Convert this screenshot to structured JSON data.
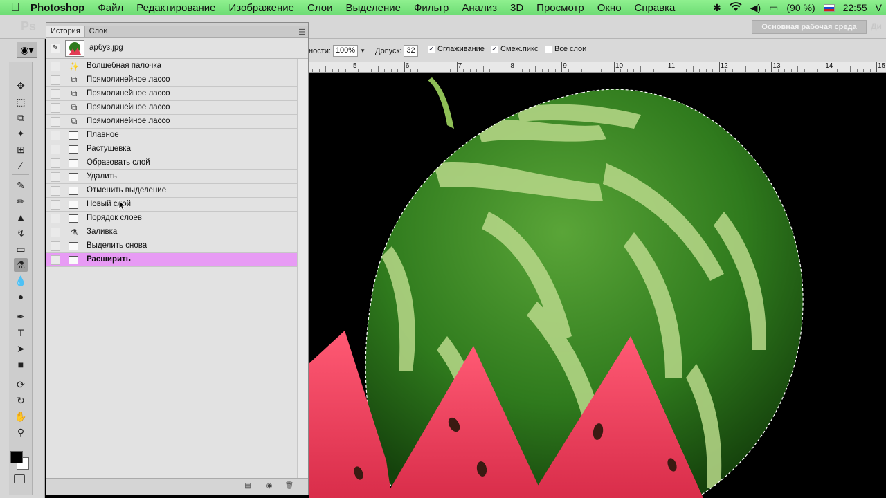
{
  "menubar": {
    "apple_icon": "apple-logo",
    "app_name": "Photoshop",
    "items": [
      "Файл",
      "Редактирование",
      "Изображение",
      "Слои",
      "Выделение",
      "Фильтр",
      "Анализ",
      "3D",
      "Просмотр",
      "Окно",
      "Справка"
    ],
    "status": {
      "battery": "(90 %)",
      "clock": "22:55",
      "user_initial": "V"
    }
  },
  "appbar": {
    "logo": "Ps",
    "workspace": "Основная рабочая среда",
    "workspace_more": "Ди"
  },
  "options": {
    "opacity_label": "ности:",
    "opacity_value": "100%",
    "tolerance_label": "Допуск:",
    "tolerance_value": "32",
    "antialias": {
      "label": "Сглаживание",
      "checked": true
    },
    "contiguous": {
      "label": "Смеж.пикс",
      "checked": true
    },
    "all_layers": {
      "label": "Все слои",
      "checked": false
    }
  },
  "ruler": {
    "labels": [
      "5",
      "6",
      "7",
      "8",
      "9",
      "10",
      "11",
      "12",
      "13",
      "14",
      "15"
    ]
  },
  "panel": {
    "tabs": [
      "История",
      "Слои"
    ],
    "snapshot_name": "арбуз.jpg",
    "history": [
      {
        "label": "Волшебная палочка",
        "icon": "magic-wand"
      },
      {
        "label": "Прямолинейное лассо",
        "icon": "polygonal-lasso"
      },
      {
        "label": "Прямолинейное лассо",
        "icon": "polygonal-lasso"
      },
      {
        "label": "Прямолинейное лассо",
        "icon": "polygonal-lasso"
      },
      {
        "label": "Прямолинейное лассо",
        "icon": "polygonal-lasso"
      },
      {
        "label": "Плавное",
        "icon": "document"
      },
      {
        "label": "Растушевка",
        "icon": "document"
      },
      {
        "label": "Образовать слой",
        "icon": "document"
      },
      {
        "label": "Удалить",
        "icon": "document"
      },
      {
        "label": "Отменить выделение",
        "icon": "document"
      },
      {
        "label": "Новый слой",
        "icon": "document"
      },
      {
        "label": "Порядок слоев",
        "icon": "document"
      },
      {
        "label": "Заливка",
        "icon": "paint-bucket"
      },
      {
        "label": "Выделить снова",
        "icon": "document"
      },
      {
        "label": "Расширить",
        "icon": "document",
        "selected": true
      }
    ]
  },
  "colors": {
    "menubar": "#7ee57e",
    "selected_row": "#e79bf4",
    "canvas": "#000000"
  }
}
